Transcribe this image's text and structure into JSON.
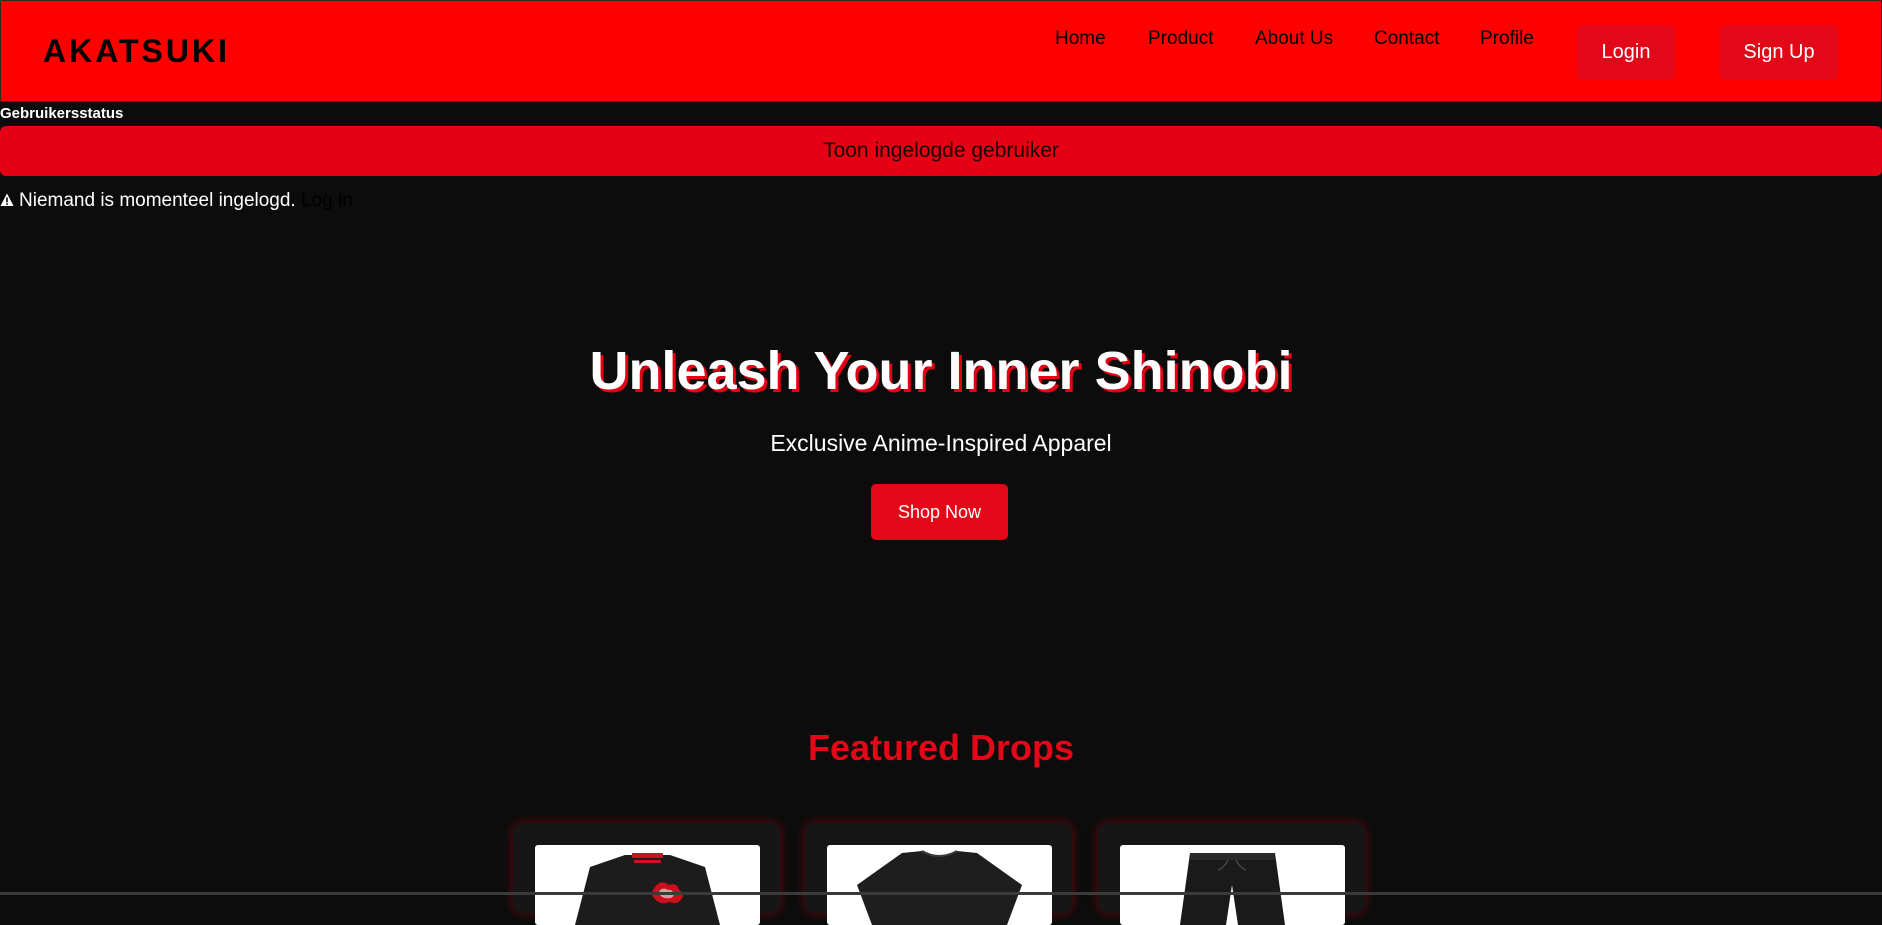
{
  "header": {
    "brand": "AKATSUKI",
    "nav": {
      "home": "Home",
      "product": "Product",
      "about": "About Us",
      "contact": "Contact",
      "profile": "Profile"
    },
    "login_label": "Login",
    "signup_label": "Sign Up"
  },
  "user_status": {
    "heading": "Gebruikersstatus",
    "show_button": "Toon ingelogde gebruiker",
    "message": "Niemand is momenteel ingelogd.",
    "login_link": "Log in"
  },
  "hero": {
    "title": "Unleash Your Inner Shinobi",
    "subtitle": "Exclusive Anime-Inspired Apparel",
    "cta": "Shop Now"
  },
  "featured": {
    "title": "Featured Drops",
    "products": [
      {
        "icon": "akatsuki-jacket-icon"
      },
      {
        "icon": "black-tshirt-icon"
      },
      {
        "icon": "black-pants-icon"
      }
    ]
  },
  "colors": {
    "header_bg": "#ff0000",
    "accent": "#e30818",
    "page_bg": "#0c0c0c"
  }
}
